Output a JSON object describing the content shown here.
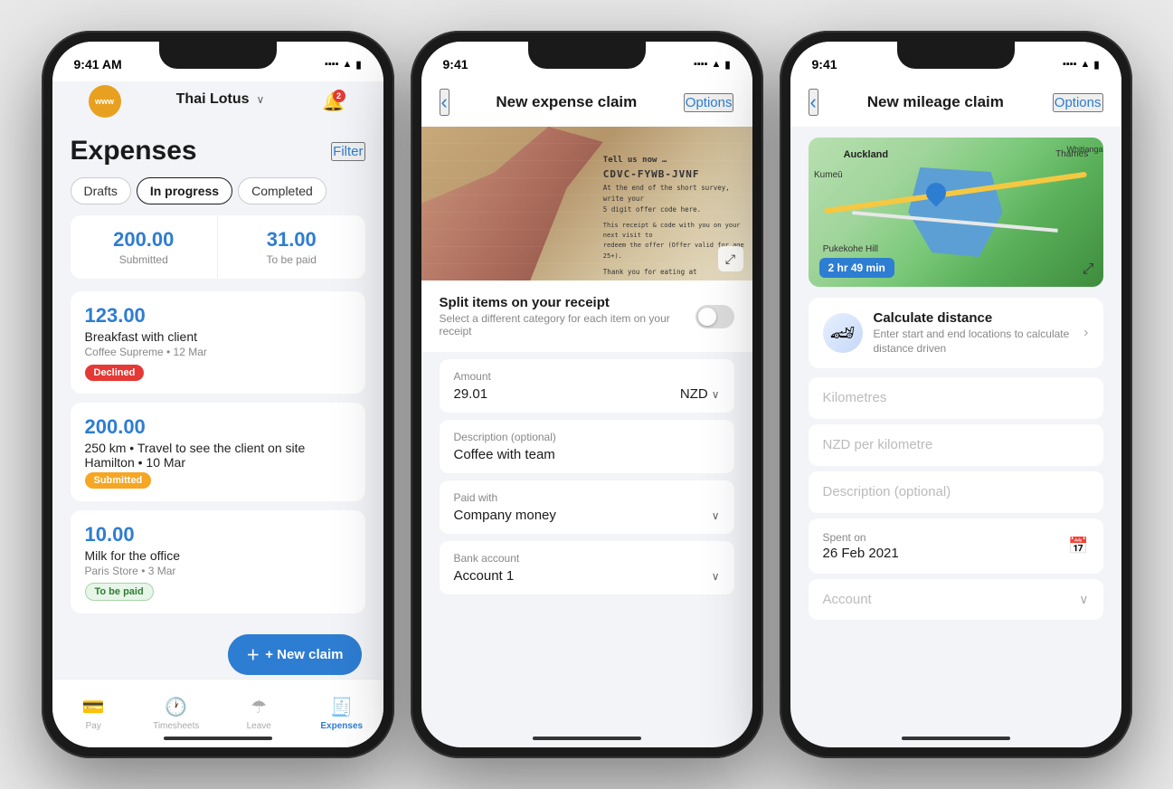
{
  "phone1": {
    "status_time": "9:41 AM",
    "company": {
      "avatar": "www",
      "name": "Thai Lotus",
      "chevron": "∨"
    },
    "notif_count": "2",
    "page_title": "Expenses",
    "filter_label": "Filter",
    "tabs": [
      "Drafts",
      "In progress",
      "Completed"
    ],
    "active_tab": "In progress",
    "stats": [
      {
        "amount": "200.00",
        "label": "Submitted"
      },
      {
        "amount": "31.00",
        "label": "To be paid"
      }
    ],
    "expenses": [
      {
        "amount": "123.00",
        "desc": "Breakfast with client",
        "sub": "Coffee Supreme • 12 Mar",
        "badge": "Declined",
        "badge_type": "declined"
      },
      {
        "amount": "200.00",
        "desc": "250 km • Travel to see the client on site Hamilton • 10 Mar",
        "sub": "",
        "badge": "Submitted",
        "badge_type": "submitted"
      },
      {
        "amount": "10.00",
        "desc": "Milk for the office",
        "sub": "Paris Store • 3 Mar",
        "badge": "To be paid",
        "badge_type": "tobepaid"
      }
    ],
    "new_claim_label": "+ New claim",
    "nav": [
      {
        "icon": "💳",
        "label": "Pay"
      },
      {
        "icon": "🕐",
        "label": "Timesheets"
      },
      {
        "icon": "🌿",
        "label": "Leave"
      },
      {
        "icon": "🧾",
        "label": "Expenses",
        "active": true
      }
    ]
  },
  "phone2": {
    "status_time": "9:41",
    "header": {
      "back": "‹",
      "title": "New expense claim",
      "options": "Options"
    },
    "split_items": {
      "label": "Split items on your receipt",
      "sublabel": "Select a different category for each item on your receipt"
    },
    "receipt_lines": [
      "Tell us now …",
      "CDVC-FYWB-JVNF",
      "At the end of the short survey, write you",
      "5 digit offer code here.",
      "",
      "This receipt & code with you on your next visit to",
      "redeem the offer (Offer valid for age 25+).",
      "",
      "Thank you for eating at"
    ],
    "fields": [
      {
        "label": "Amount",
        "value": "29.01",
        "extra": "NZD",
        "type": "amount"
      },
      {
        "label": "Description (optional)",
        "value": "Coffee with team",
        "type": "text"
      },
      {
        "label": "Paid with",
        "value": "Company money",
        "type": "select"
      },
      {
        "label": "Bank account",
        "value": "Account 1",
        "type": "select"
      }
    ]
  },
  "phone3": {
    "status_time": "9:41",
    "header": {
      "back": "‹",
      "title": "New mileage claim",
      "options": "Options"
    },
    "map": {
      "time": "2 hr 49 min",
      "labels": {
        "auckland": "Auckland",
        "pukekohe": "Pukekohe Hill",
        "thames": "Thames",
        "kumehu": "Kumeū",
        "whitianga": "Whitianga"
      }
    },
    "calc_distance": {
      "title": "Calculate distance",
      "subtitle": "Enter start and end locations to calculate distance driven"
    },
    "fields": [
      {
        "label": "Kilometres",
        "value": "",
        "sublabel": ""
      },
      {
        "label": "NZD per kilometre",
        "value": "",
        "sublabel": ""
      },
      {
        "label": "Description (optional)",
        "value": "",
        "sublabel": ""
      },
      {
        "label": "Spent on",
        "value": "26 Feb 2021",
        "sublabel": "Spent on",
        "type": "date"
      },
      {
        "label": "Account",
        "value": "",
        "sublabel": "",
        "type": "select"
      }
    ]
  }
}
